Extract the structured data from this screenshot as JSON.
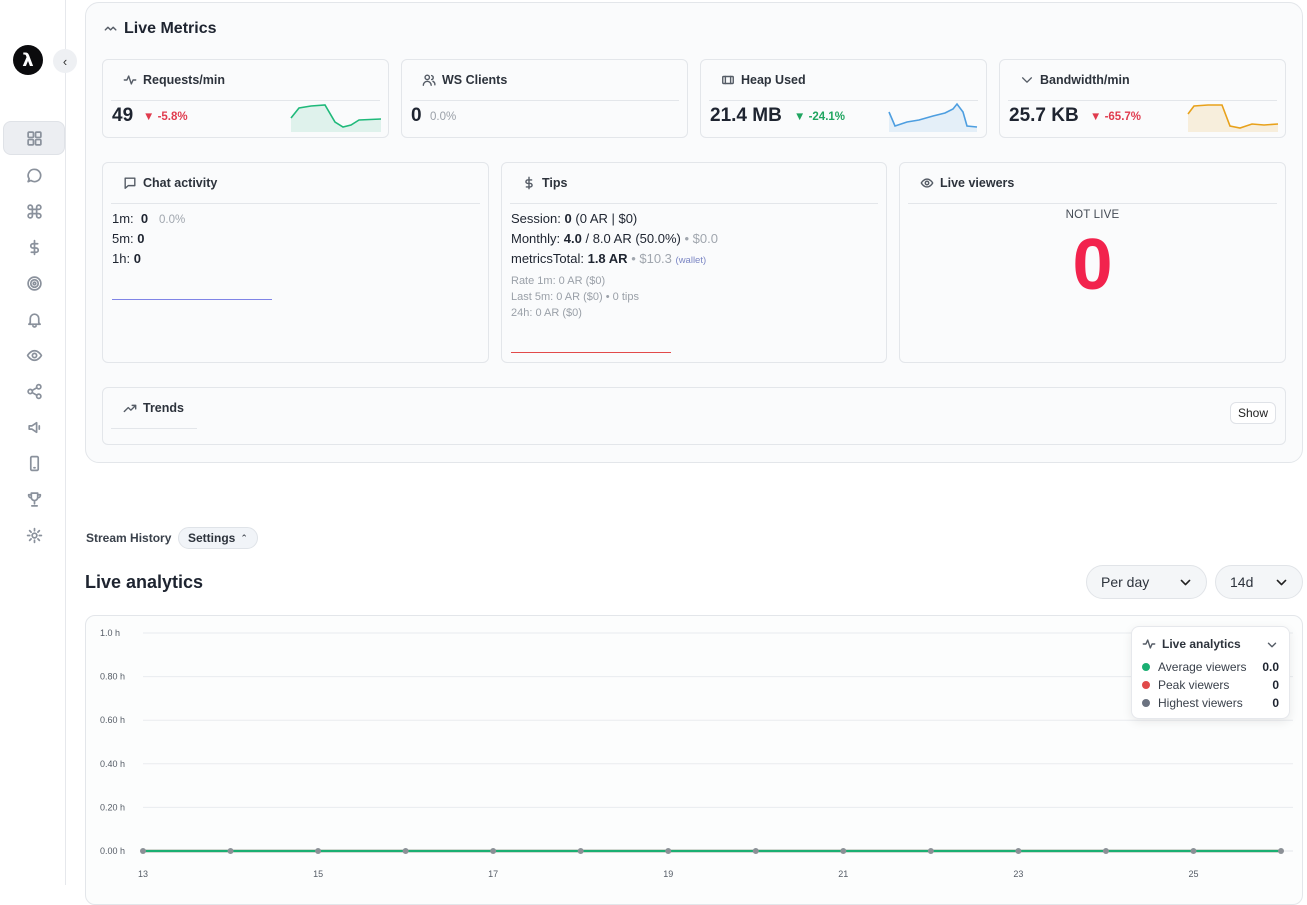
{
  "sidebar": {
    "logo_glyph": "λ",
    "collapse_glyph": "‹",
    "items": [
      {
        "icon": "dashboard-grid-icon",
        "active": true
      },
      {
        "icon": "chat-bubble-icon"
      },
      {
        "icon": "command-icon"
      },
      {
        "icon": "dollar-icon"
      },
      {
        "icon": "target-icon"
      },
      {
        "icon": "bell-icon"
      },
      {
        "icon": "eye-icon"
      },
      {
        "icon": "share-icon"
      },
      {
        "icon": "megaphone-icon"
      },
      {
        "icon": "phone-icon"
      },
      {
        "icon": "trophy-icon"
      },
      {
        "icon": "gear-icon"
      }
    ]
  },
  "live_metrics": {
    "title": "Live Metrics",
    "cards": {
      "requests": {
        "label": "Requests/min",
        "value": "49",
        "delta": "▼ -5.8%"
      },
      "ws": {
        "label": "WS Clients",
        "value": "0",
        "delta": "0.0%"
      },
      "heap": {
        "label": "Heap Used",
        "value": "21.4 MB",
        "delta": "▼ -24.1%"
      },
      "bandwidth": {
        "label": "Bandwidth/min",
        "value": "25.7 KB",
        "delta": "▼ -65.7%"
      }
    },
    "chat": {
      "label": "Chat activity",
      "rows": [
        {
          "key": "1m:",
          "value": "0",
          "pct": "0.0%"
        },
        {
          "key": "5m:",
          "value": "0"
        },
        {
          "key": "1h:",
          "value": "0"
        }
      ]
    },
    "tips": {
      "label": "Tips",
      "session_key": "Session:",
      "session_val": "0",
      "session_rest": "(0 AR | $0)",
      "monthly_key": "Monthly:",
      "monthly_val": "4.0",
      "monthly_rest": "/ 8.0 AR (50.0%)",
      "monthly_usd": "• $0.0",
      "total_key": "metricsTotal:",
      "total_val": "1.8 AR",
      "total_usd": "• $10.3",
      "total_wallet": "(wallet)",
      "rate_1m": "Rate 1m: 0 AR ($0)",
      "last_5m": "Last 5m: 0 AR ($0) • 0 tips",
      "last_24h": "24h: 0 AR ($0)"
    },
    "viewers": {
      "label": "Live viewers",
      "status": "NOT LIVE",
      "count": "0"
    },
    "trends": {
      "label": "Trends",
      "show_label": "Show"
    }
  },
  "history": {
    "label": "Stream History",
    "settings_label": "Settings",
    "settings_glyph": "⌃",
    "analytics_title": "Live analytics",
    "period": "Per day",
    "range": "14d"
  },
  "colors": {
    "avg": "#1aaf72",
    "peak": "#e04a4a",
    "highest": "#6b7280",
    "viewers_zero": "#f2234d"
  },
  "chart_data": {
    "type": "line",
    "title": "Live analytics",
    "xlabel": "",
    "ylabel": "",
    "x": [
      13,
      14,
      15,
      16,
      17,
      18,
      19,
      20,
      21,
      22,
      23,
      24,
      25,
      26
    ],
    "x_tick_labels": [
      "13",
      "15",
      "17",
      "19",
      "21",
      "23",
      "25"
    ],
    "y_tick_labels": [
      "0.00 h",
      "0.20 h",
      "0.40 h",
      "0.60 h",
      "0.80 h",
      "1.0 h"
    ],
    "ylim": [
      0,
      1.0
    ],
    "grid": true,
    "legend_position": "top-right",
    "series": [
      {
        "name": "Average viewers",
        "values": [
          0,
          0,
          0,
          0,
          0,
          0,
          0,
          0,
          0,
          0,
          0,
          0,
          0,
          0
        ],
        "legend_value": "0.0"
      },
      {
        "name": "Peak viewers",
        "values": [
          0,
          0,
          0,
          0,
          0,
          0,
          0,
          0,
          0,
          0,
          0,
          0,
          0,
          0
        ],
        "legend_value": "0"
      },
      {
        "name": "Highest viewers",
        "values": [
          0,
          0,
          0,
          0,
          0,
          0,
          0,
          0,
          0,
          0,
          0,
          0,
          0,
          0
        ],
        "legend_value": "0"
      }
    ]
  }
}
